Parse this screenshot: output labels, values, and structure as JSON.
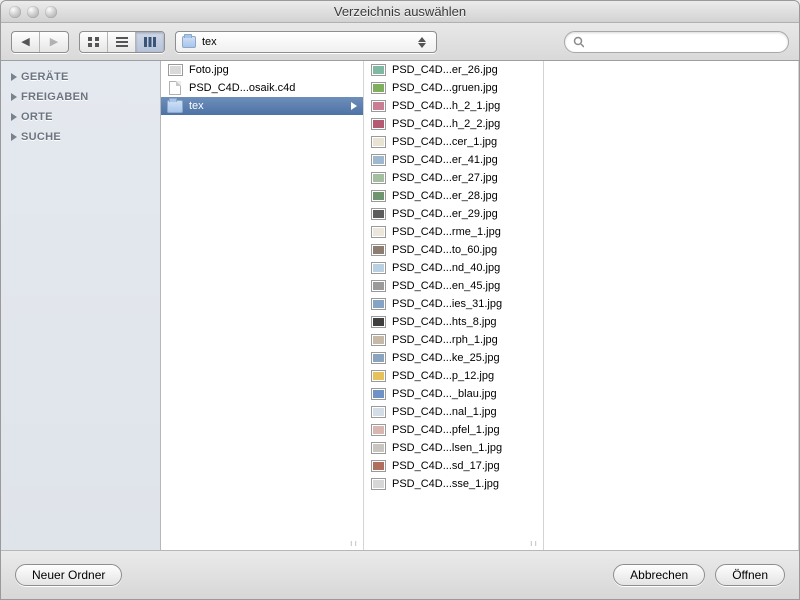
{
  "window": {
    "title": "Verzeichnis auswählen"
  },
  "toolbar": {
    "path_label": "tex",
    "search_placeholder": ""
  },
  "sidebar": {
    "headers": [
      "GERÄTE",
      "FREIGABEN",
      "ORTE",
      "SUCHE"
    ]
  },
  "column1": [
    {
      "kind": "image",
      "name": "Foto.jpg",
      "tint": "#d9d9d9"
    },
    {
      "kind": "file",
      "name": "PSD_C4D...osaik.c4d"
    },
    {
      "kind": "folder",
      "name": "tex",
      "selected": true,
      "has_children": true
    }
  ],
  "column2": [
    {
      "name": "PSD_C4D...er_26.jpg",
      "tint": "#7fb9a3"
    },
    {
      "name": "PSD_C4D...gruen.jpg",
      "tint": "#7fae5d"
    },
    {
      "name": "PSD_C4D...h_2_1.jpg",
      "tint": "#c97e93"
    },
    {
      "name": "PSD_C4D...h_2_2.jpg",
      "tint": "#b55a73"
    },
    {
      "name": "PSD_C4D...cer_1.jpg",
      "tint": "#e8e3d3"
    },
    {
      "name": "PSD_C4D...er_41.jpg",
      "tint": "#9fb7cf"
    },
    {
      "name": "PSD_C4D...er_27.jpg",
      "tint": "#a4bfa0"
    },
    {
      "name": "PSD_C4D...er_28.jpg",
      "tint": "#6f9470"
    },
    {
      "name": "PSD_C4D...er_29.jpg",
      "tint": "#5c5c5c"
    },
    {
      "name": "PSD_C4D...rme_1.jpg",
      "tint": "#ece7dc"
    },
    {
      "name": "PSD_C4D...to_60.jpg",
      "tint": "#8d7c70"
    },
    {
      "name": "PSD_C4D...nd_40.jpg",
      "tint": "#b9cfe2"
    },
    {
      "name": "PSD_C4D...en_45.jpg",
      "tint": "#9a9a9a"
    },
    {
      "name": "PSD_C4D...ies_31.jpg",
      "tint": "#85a4c3"
    },
    {
      "name": "PSD_C4D...hts_8.jpg",
      "tint": "#3f3f3f"
    },
    {
      "name": "PSD_C4D...rph_1.jpg",
      "tint": "#c6b9a8"
    },
    {
      "name": "PSD_C4D...ke_25.jpg",
      "tint": "#8aa3bf"
    },
    {
      "name": "PSD_C4D...p_12.jpg",
      "tint": "#e7c15b"
    },
    {
      "name": "PSD_C4D..._blau.jpg",
      "tint": "#6e92c6"
    },
    {
      "name": "PSD_C4D...nal_1.jpg",
      "tint": "#d4dde6"
    },
    {
      "name": "PSD_C4D...pfel_1.jpg",
      "tint": "#d8b7b2"
    },
    {
      "name": "PSD_C4D...lsen_1.jpg",
      "tint": "#c9c6c1"
    },
    {
      "name": "PSD_C4D...sd_17.jpg",
      "tint": "#b06f5e"
    },
    {
      "name": "PSD_C4D...sse_1.jpg",
      "tint": "#d7d7d7"
    }
  ],
  "buttons": {
    "new_folder": "Neuer Ordner",
    "cancel": "Abbrechen",
    "open": "Öffnen"
  }
}
